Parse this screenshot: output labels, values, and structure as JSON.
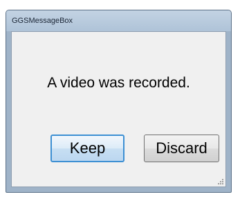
{
  "window": {
    "title": "GGSMessageBox"
  },
  "dialog": {
    "message": "A video was recorded.",
    "buttons": {
      "keep_label": "Keep",
      "discard_label": "Discard"
    }
  },
  "icons": {
    "resize_grip": "resize-grip-icon"
  },
  "colors": {
    "focus_border": "#3c8fd3",
    "title_bar": "#afc3d8",
    "client_background": "#f0f0f0"
  }
}
